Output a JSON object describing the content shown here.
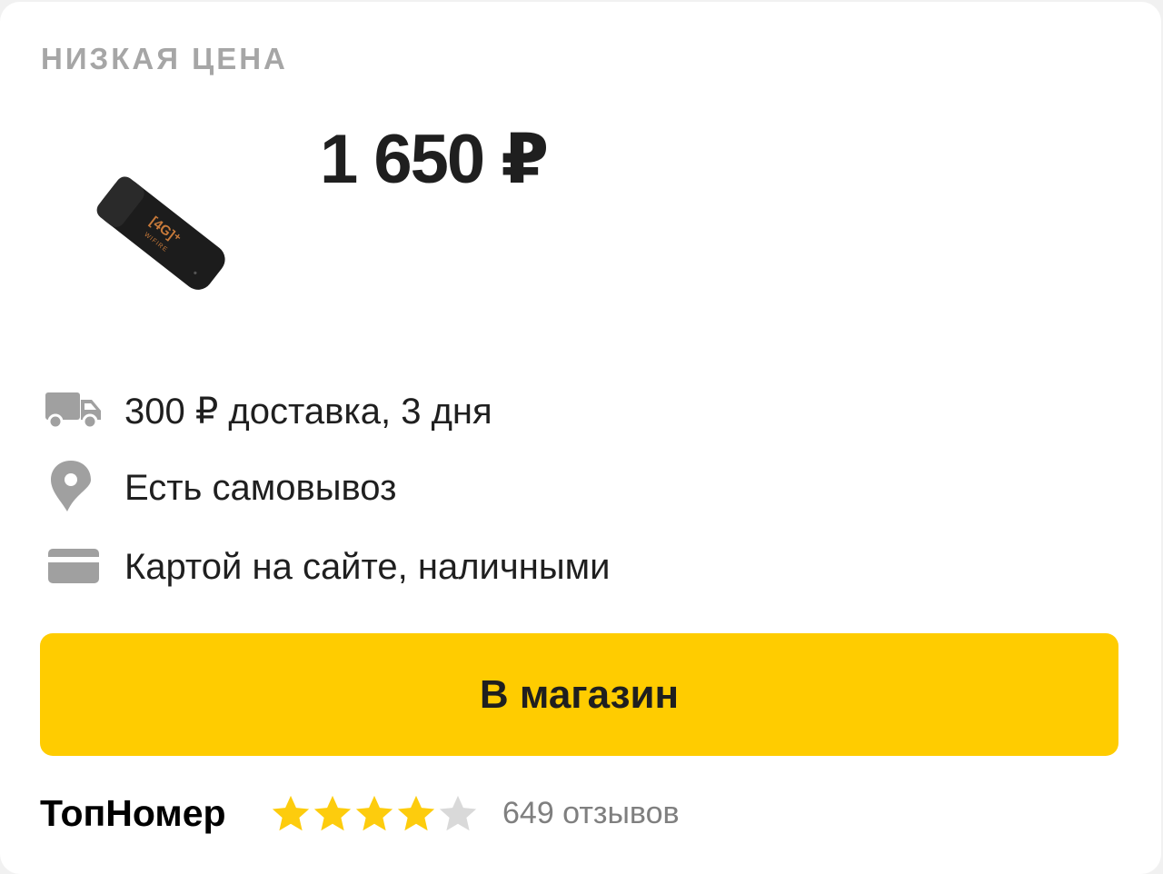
{
  "offer": {
    "badge": "НИЗКАЯ ЦЕНА",
    "price": "1 650 ₽",
    "device_label": "[4G]⁺",
    "device_sublabel": "WIFIRE"
  },
  "info": {
    "delivery": "300 ₽ доставка, 3 дня",
    "pickup": "Есть самовывоз",
    "payment": "Картой на сайте, наличными"
  },
  "button": {
    "label": "В магазин"
  },
  "shop": {
    "name": "ТопНомер",
    "rating": 4,
    "rating_max": 5,
    "reviews": "649 отзывов"
  },
  "colors": {
    "accent": "#ffcc00",
    "star_filled": "#fdcc0d",
    "star_empty": "#d9d9d9",
    "icon": "#a0a0a0",
    "badge": "#a6a6a6"
  },
  "icons": {
    "delivery": "truck-icon",
    "pickup": "map-pin-icon",
    "payment": "credit-card-icon",
    "star": "star-icon"
  }
}
